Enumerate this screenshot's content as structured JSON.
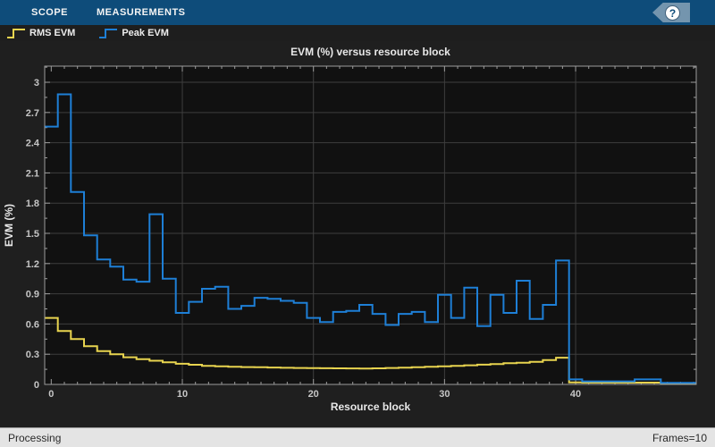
{
  "toolbar": {
    "tabs": [
      {
        "label": "SCOPE"
      },
      {
        "label": "MEASUREMENTS"
      }
    ],
    "help_glyph": "?"
  },
  "status_bar": {
    "left": "Processing",
    "right": "Frames=10"
  },
  "colors": {
    "toolbar_bg": "#0e4c7a",
    "help_tag": "#7495ae",
    "figure_bg": "#1f1f1f",
    "axes_bg": "#111111",
    "grid": "#3e3e3e",
    "axis": "#9c9c9c",
    "tick_label": "#c6c6c6",
    "text": "#e8e8e8",
    "status_bg": "#e4e4e4",
    "rms_evm": "#e8d44f",
    "peak_evm": "#1e7fd6"
  },
  "chart_data": {
    "type": "line",
    "line_style": "stairstep",
    "title": "EVM (%) versus resource block",
    "xlabel": "Resource block",
    "ylabel": "EVM (%)",
    "xlim": [
      -0.5,
      49.2
    ],
    "ylim": [
      0,
      3.16
    ],
    "x_major_ticks": [
      0,
      10,
      20,
      30,
      40
    ],
    "x_minor_step": 1,
    "y_major_ticks": [
      0,
      0.3,
      0.6,
      0.9,
      1.2,
      1.5,
      1.8,
      2.1,
      2.4,
      2.7,
      3
    ],
    "y_minor_step": 0.15,
    "grid": true,
    "legend_position": "top-bar-left",
    "x": [
      0,
      1,
      2,
      3,
      4,
      5,
      6,
      7,
      8,
      9,
      10,
      11,
      12,
      13,
      14,
      15,
      16,
      17,
      18,
      19,
      20,
      21,
      22,
      23,
      24,
      25,
      26,
      27,
      28,
      29,
      30,
      31,
      32,
      33,
      34,
      35,
      36,
      37,
      38,
      39,
      40,
      41,
      42,
      43,
      44,
      45,
      46,
      47,
      48,
      49
    ],
    "series": [
      {
        "name": "RMS EVM",
        "color": "#e8d44f",
        "values": [
          0.66,
          0.53,
          0.45,
          0.38,
          0.33,
          0.3,
          0.27,
          0.25,
          0.235,
          0.22,
          0.205,
          0.195,
          0.185,
          0.18,
          0.175,
          0.172,
          0.17,
          0.168,
          0.165,
          0.163,
          0.162,
          0.161,
          0.16,
          0.159,
          0.158,
          0.16,
          0.163,
          0.166,
          0.17,
          0.175,
          0.18,
          0.185,
          0.19,
          0.196,
          0.202,
          0.21,
          0.216,
          0.225,
          0.242,
          0.265,
          0.02,
          0.018,
          0.018,
          0.018,
          0.018,
          0.018,
          0.018,
          0.012,
          0.012,
          0.012
        ]
      },
      {
        "name": "Peak EVM",
        "color": "#1e7fd6",
        "values": [
          2.56,
          2.88,
          1.91,
          1.48,
          1.24,
          1.17,
          1.04,
          1.02,
          1.69,
          1.05,
          0.71,
          0.82,
          0.95,
          0.97,
          0.75,
          0.78,
          0.86,
          0.85,
          0.83,
          0.81,
          0.66,
          0.62,
          0.72,
          0.73,
          0.79,
          0.7,
          0.59,
          0.7,
          0.72,
          0.62,
          0.89,
          0.66,
          0.96,
          0.58,
          0.89,
          0.71,
          1.03,
          0.65,
          0.79,
          1.23,
          0.05,
          0.03,
          0.03,
          0.03,
          0.03,
          0.05,
          0.05,
          0.015,
          0.015,
          0.015
        ]
      }
    ]
  }
}
